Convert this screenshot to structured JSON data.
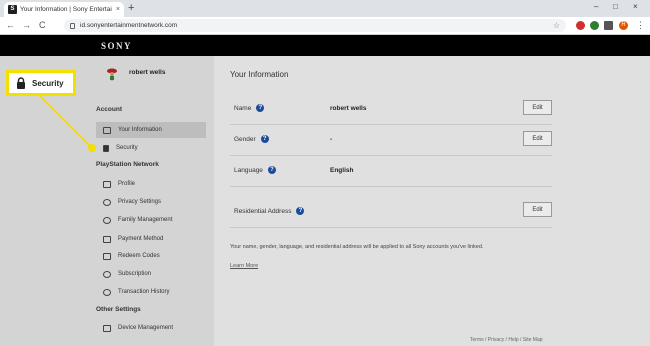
{
  "browser": {
    "tab_title": "Your Information | Sony Entertai",
    "tab_favicon": "S",
    "close_glyph": "×",
    "new_tab_glyph": "+",
    "url": "id.sonyentertainmentnetwork.com",
    "window_controls": [
      "–",
      "□",
      "×"
    ],
    "nav": {
      "back": "←",
      "forward": "→",
      "reload": "C"
    },
    "profile_initial": "R"
  },
  "header": {
    "logo": "SONY"
  },
  "sidebar": {
    "user_name": "robert wells",
    "sections": [
      {
        "title": "Account",
        "items": [
          "Your Information",
          "Security"
        ]
      },
      {
        "title": "PlayStation Network",
        "items": [
          "Profile",
          "Privacy Settings",
          "Family Management",
          "Payment Method",
          "Redeem Codes",
          "Subscription",
          "Transaction History"
        ]
      },
      {
        "title": "Other Settings",
        "items": [
          "Device Management"
        ]
      }
    ],
    "active_item": "Your Information"
  },
  "main": {
    "title": "Your Information",
    "rows": [
      {
        "label": "Name",
        "value": "robert wells",
        "button": "Edit"
      },
      {
        "label": "Gender",
        "value": "-",
        "button": "Edit"
      },
      {
        "label": "Language",
        "value": "English",
        "button": ""
      },
      {
        "label": "Residential Address",
        "value": "",
        "button": "Edit"
      }
    ],
    "help_glyph": "?",
    "note": "Your name, gender, language, and residential address will be applied to all Sony accounts you've linked.",
    "learn_more": "Learn More",
    "footer": "Terms / Privacy / Help / Site Map"
  },
  "callout": {
    "label": "Security",
    "color": "#f2e000"
  },
  "colors": {
    "sony_bar": "#000000",
    "help_icon": "#1d4b9a",
    "sidebar_bg": "#d4d4d4",
    "main_bg": "#e0e0e0"
  }
}
